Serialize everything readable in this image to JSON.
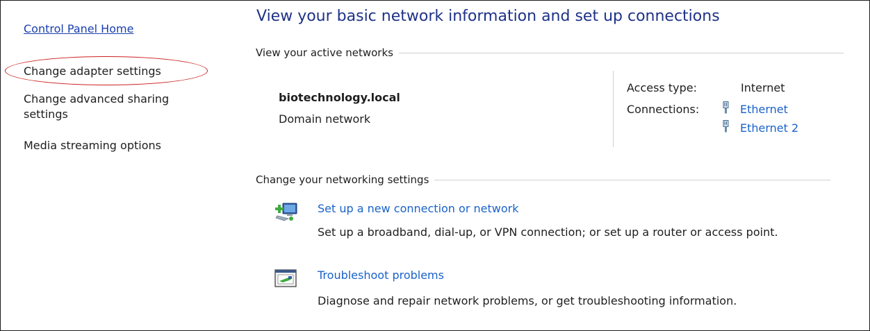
{
  "sidebar": {
    "home_link": "Control Panel Home",
    "items": [
      {
        "label": "Change adapter settings"
      },
      {
        "label": "Change advanced sharing"
      },
      {
        "label": "settings"
      },
      {
        "label": "Media streaming options"
      }
    ]
  },
  "main": {
    "title": "View your basic network information and set up connections",
    "active_networks": {
      "heading": "View your active networks",
      "network_name": "biotechnology.local",
      "network_type": "Domain network",
      "access_type_label": "Access type:",
      "access_type_value": "Internet",
      "connections_label": "Connections:",
      "connections": [
        "Ethernet",
        "Ethernet 2"
      ]
    },
    "networking_settings": {
      "heading": "Change your networking settings",
      "tasks": [
        {
          "icon": "new-connection-icon",
          "link": "Set up a new connection or network",
          "description": "Set up a broadband, dial-up, or VPN connection; or set up a router or access point."
        },
        {
          "icon": "troubleshoot-icon",
          "link": "Troubleshoot problems",
          "description": "Diagnose and repair network problems, or get troubleshooting information."
        }
      ]
    }
  },
  "colors": {
    "link": "#1a62c9",
    "title": "#1e3287",
    "highlight": "#cc1f1f"
  }
}
